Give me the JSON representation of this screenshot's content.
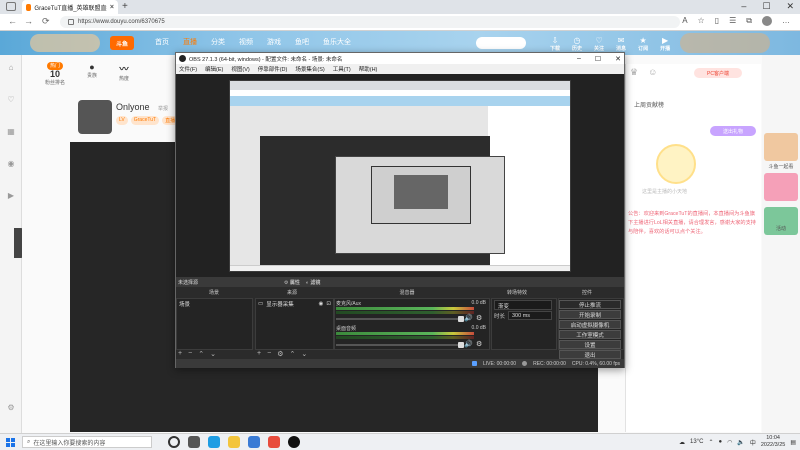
{
  "browser": {
    "tab_title": "GraceTuT直播_英雄联盟直播_斗鱼",
    "url": "https://www.douyu.com/6370675",
    "colors": {
      "tab_bg": "#ffffff",
      "accent": "#ff7a00"
    }
  },
  "douyu": {
    "logo_text": "斗鱼",
    "nav": [
      "首页",
      "直播",
      "分类",
      "视频",
      "游戏",
      "鱼吧",
      "鱼乐大全"
    ],
    "active_nav": "直播",
    "head_icons": [
      "下载",
      "历史",
      "关注",
      "消息",
      "订阅",
      "开播"
    ],
    "stats": [
      {
        "value": "10",
        "label": "粉丝排名"
      },
      {
        "value": "",
        "label": "贵族"
      },
      {
        "value": "",
        "label": "热度"
      }
    ],
    "badge": "热门",
    "streamer_name": "Onlyone",
    "streamer_sub": "举报",
    "tags": [
      "LV",
      "GraceTuT",
      "直播中"
    ],
    "right_panel": {
      "pc_button": "PC客户端",
      "header": "上周贡献榜",
      "gift_button": "送出礼物",
      "note": "这里是主播的小天地",
      "text": "公告：欢迎来到GraceTuT的直播间，本直播间为斗鱼旗下主播进行LoL相关直播，请合理发言，感谢大家的支持与陪伴，喜欢的话可以点个关注。"
    },
    "far_right": [
      {
        "label": "斗鱼一起看"
      },
      {
        "label": ""
      },
      {
        "label": "活动"
      }
    ]
  },
  "obs": {
    "title": "OBS 27.1.3 (64-bit, windows) - 配置文件: 未命名 - 场景: 未命名",
    "menu": [
      "文件(F)",
      "编辑(E)",
      "视图(V)",
      "停靠部件(D)",
      "场景集合(S)",
      "工具(T)",
      "帮助(H)"
    ],
    "no_source": "未选择源",
    "properties_btn": "属性",
    "filters_btn": "滤镜",
    "docks": {
      "scenes": "场景",
      "sources": "来源",
      "mixer": "混音器",
      "transitions": "转场特效",
      "controls": "控件"
    },
    "scene_items": [
      "场景"
    ],
    "source_items": [
      "显示器采集"
    ],
    "mixer": [
      {
        "name": "麦克风/Aux",
        "db": "0.0 dB"
      },
      {
        "name": "桌面音频",
        "db": "0.0 dB"
      }
    ],
    "transition_value": "渐变",
    "duration_label": "时长",
    "duration_value": "300 ms",
    "controls": [
      "停止推流",
      "开始录制",
      "启动虚拟摄像机",
      "工作室模式",
      "设置",
      "退出"
    ],
    "status": {
      "live": "LIVE: 00:00:00",
      "rec": "REC: 00:00:00",
      "cpu": "CPU: 0.4%, 60.00 fps"
    }
  },
  "taskbar": {
    "search_placeholder": "在这里输入你要搜索的内容",
    "weather": "13°C",
    "time": "10:04",
    "date": "2022/3/25"
  }
}
